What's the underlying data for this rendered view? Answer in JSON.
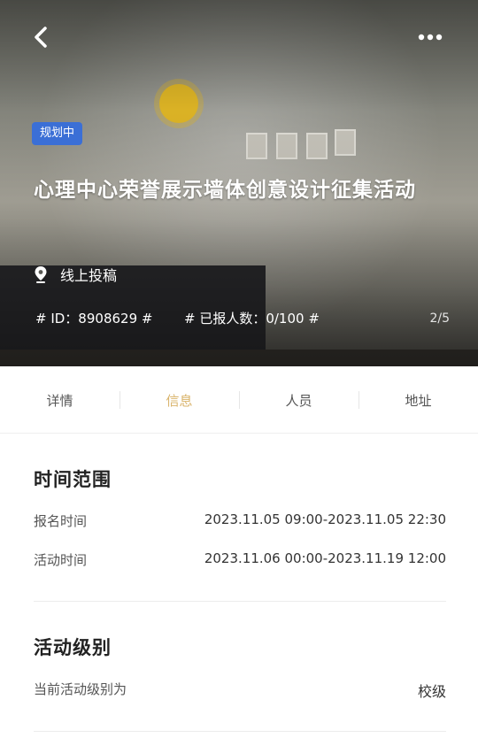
{
  "hero": {
    "badge": "规划中",
    "title": "心理中心荣誉展示墙体创意设计征集活动",
    "location": "线上投稿",
    "id_text": "# ID：8908629 #",
    "count_text": "# 已报人数：0/100 #",
    "page_indicator": "2/5",
    "icons": {
      "back": "chevron-left-icon",
      "more": "more-horizontal-icon",
      "location": "map-pin-icon"
    }
  },
  "tabs": [
    {
      "label": "详情",
      "active": false
    },
    {
      "label": "信息",
      "active": true
    },
    {
      "label": "人员",
      "active": false
    },
    {
      "label": "地址",
      "active": false
    }
  ],
  "time_section": {
    "title": "时间范围",
    "rows": [
      {
        "label": "报名时间",
        "value": "2023.11.05 09:00-2023.11.05 22:30"
      },
      {
        "label": "活动时间",
        "value": "2023.11.06 00:00-2023.11.19 12:00"
      }
    ]
  },
  "level_section": {
    "title": "活动级别",
    "label": "当前活动级别为",
    "value": "校级"
  },
  "colors": {
    "badge": "#3b6fd6",
    "active_tab": "#d9b36a"
  }
}
